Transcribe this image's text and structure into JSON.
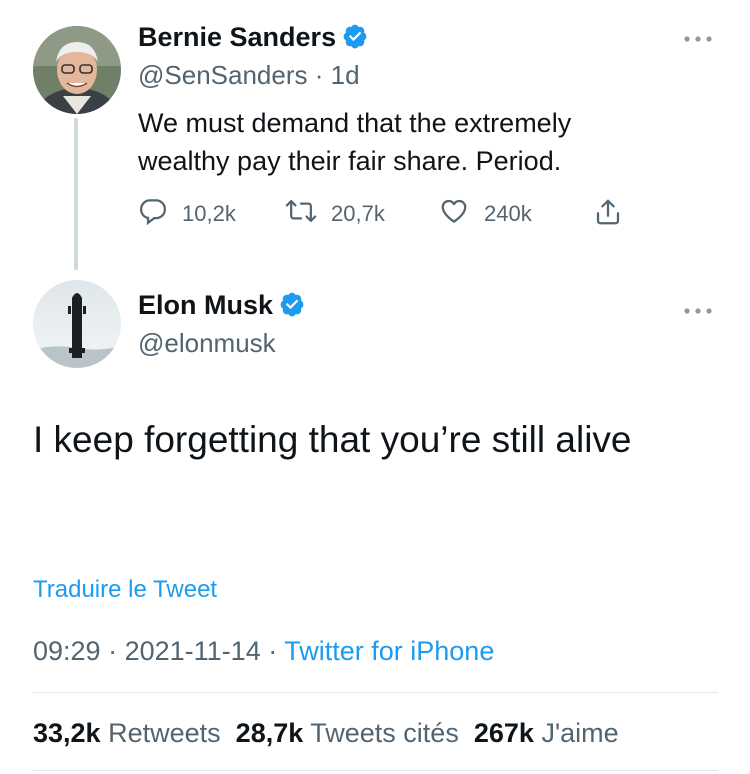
{
  "colors": {
    "accent": "#1d9bf0",
    "text": "#0f1419",
    "secondary": "#536471",
    "divider": "#e1e6ea"
  },
  "quoted_tweet": {
    "author_name": "Bernie Sanders",
    "handle": "@SenSanders",
    "separator": "·",
    "time": "1d",
    "verified": true,
    "text": "We must demand that the extremely wealthy pay their fair share. Period.",
    "actions": {
      "replies": "10,2k",
      "retweets": "20,7k",
      "likes": "240k"
    },
    "icons": {
      "reply": "reply-icon",
      "retweet": "retweet-icon",
      "like": "heart-icon",
      "share": "share-icon",
      "more": "more-icon"
    }
  },
  "reply_tweet": {
    "author_name": "Elon Musk",
    "handle": "@elonmusk",
    "verified": true,
    "text": "I keep forgetting that you’re still alive",
    "translate_label": "Traduire le Tweet",
    "time": "09:29",
    "date": "2021-11-14",
    "separator": "·",
    "source": "Twitter for iPhone"
  },
  "stats": {
    "retweets_count": "33,2k",
    "retweets_label": "Retweets",
    "quotes_count": "28,7k",
    "quotes_label": "Tweets cités",
    "likes_count": "267k",
    "likes_label": "J'aime"
  }
}
